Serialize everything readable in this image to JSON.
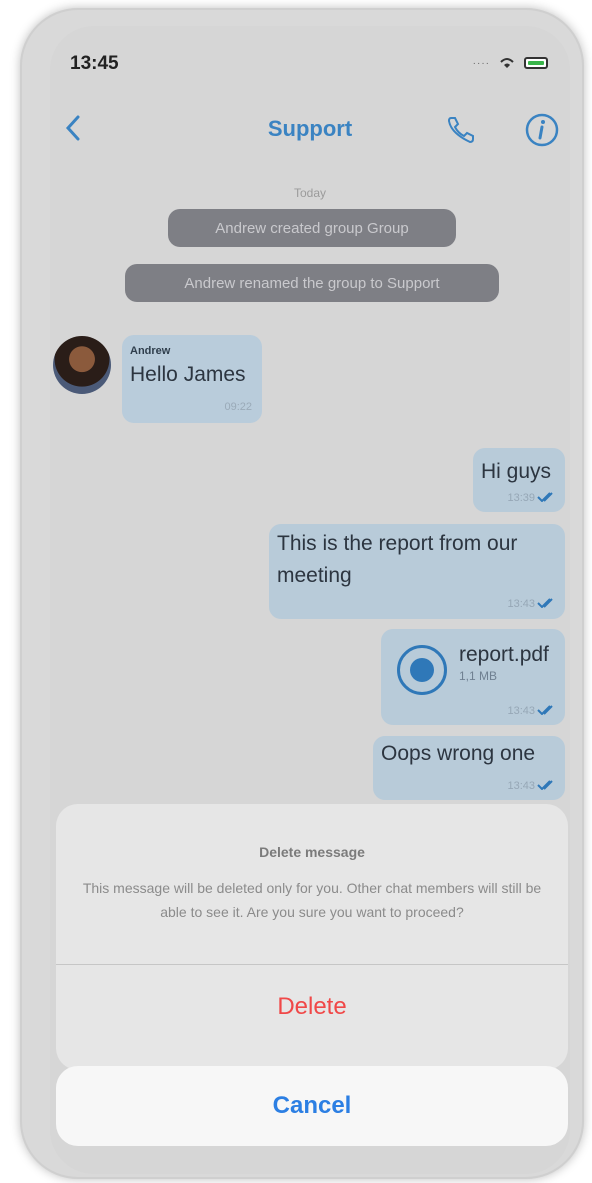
{
  "status_bar": {
    "time": "13:45"
  },
  "nav": {
    "title": "Support"
  },
  "chat": {
    "date": "Today",
    "system_messages": [
      "Andrew created group Group",
      "Andrew renamed the group to Support"
    ],
    "incoming": {
      "sender": "Andrew",
      "text": "Hello James",
      "time": "09:22"
    },
    "outgoing": [
      {
        "text": "Hi guys",
        "time": "13:39"
      },
      {
        "text": "This is the report from our meeting",
        "time": "13:43"
      },
      {
        "file_name": "report.pdf",
        "file_size": "1,1 MB",
        "time": "13:43"
      },
      {
        "text": "Oops wrong one",
        "time": "13:43"
      }
    ]
  },
  "dialog": {
    "title": "Delete message",
    "message": "This message will be deleted only for you. Other chat members will still be able to see it. Are you sure you want to proceed?",
    "delete_label": "Delete",
    "cancel_label": "Cancel"
  },
  "colors": {
    "accent": "#3a83c2",
    "danger": "#f04848",
    "cancel": "#2c7fe3"
  },
  "icons": [
    "back-chevron-icon",
    "phone-icon",
    "info-icon",
    "file-icon",
    "read-check-icon",
    "wifi-icon",
    "battery-icon"
  ]
}
